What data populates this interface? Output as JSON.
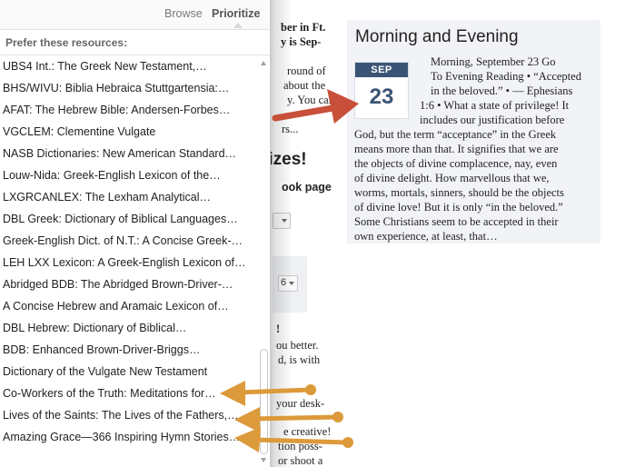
{
  "panel": {
    "tabs": {
      "browse": "Browse",
      "prioritize": "Prioritize"
    },
    "section_label": "Prefer these resources:",
    "items": [
      "UBS4 Int.: The Greek New Testament,…",
      "BHS/WIVU: Biblia Hebraica Stuttgartensia:…",
      "AFAT: The Hebrew Bible: Andersen-Forbes…",
      "VGCLEM: Clementine Vulgate",
      "NASB Dictionaries: New American Standard…",
      "Louw-Nida: Greek-English Lexicon of the…",
      "LXGRCANLEX: The Lexham Analytical…",
      "DBL Greek: Dictionary of Biblical Languages…",
      "Greek-English Dict. of N.T.: A Concise Greek-…",
      "LEH LXX Lexicon: A Greek-English Lexicon of…",
      "Abridged BDB: The Abridged Brown-Driver-…",
      "A Concise Hebrew and Aramaic Lexicon of…",
      "DBL Hebrew: Dictionary of Biblical…",
      "BDB: Enhanced Brown-Driver-Briggs…",
      "Dictionary of the Vulgate New Testament",
      "Co-Workers of the Truth: Meditations for…",
      "Lives of the Saints: The Lives of the Fathers,…",
      "Amazing Grace—366 Inspiring Hymn Stories…"
    ]
  },
  "card": {
    "title": "Morning and Evening",
    "calendar_month": "SEP",
    "calendar_day": "23",
    "lines": [
      "Morning, September 23      Go",
      "To Evening Reading • “Accepted",
      "in the beloved.” • — Ephesians",
      "1:6 • What a state of privilege! It",
      "includes our justification before",
      "God, but the term “acceptance” in the Greek",
      "means more than that. It signifies that we are",
      "the objects of divine complacence, nay, even",
      "of divine delight. How marvellous that we,",
      "worms, mortals, sinners, should be the objects",
      "of divine love! But it is only “in the beloved.”",
      "Some Christians seem to be accepted in their",
      "own experience, at least, that…"
    ]
  },
  "background": {
    "fragments": [
      "ber in Ft.",
      "y is Sep-",
      "round of",
      "about the",
      "y. You can",
      "rs...",
      "rizes!",
      "ook page",
      "!",
      "ou better.",
      "d, is with",
      "your desk-",
      "e creative!",
      "tion poss-",
      "or shoot a"
    ]
  },
  "colors": {
    "red_arrow": "#c8503a",
    "orange_arrow": "#dc9a3a",
    "calendar_blue": "#3b5475",
    "card_bg": "#f1f3f6"
  }
}
